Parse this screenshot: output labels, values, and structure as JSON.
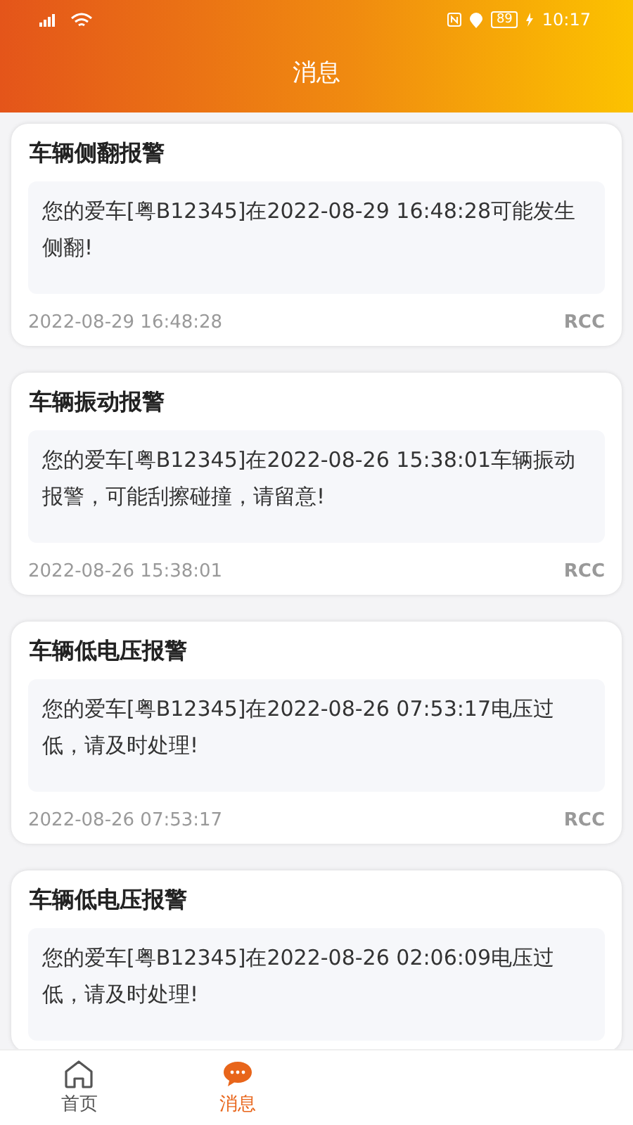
{
  "status_bar": {
    "battery": "89",
    "time": "10:17"
  },
  "header": {
    "title": "消息"
  },
  "messages": [
    {
      "title": "车辆侧翻报警",
      "body": "您的爱车[粤B12345]在2022-08-29 16:48:28可能发生侧翻!",
      "time": "2022-08-29 16:48:28",
      "source": "RCC"
    },
    {
      "title": "车辆振动报警",
      "body": "您的爱车[粤B12345]在2022-08-26 15:38:01车辆振动报警，可能刮擦碰撞，请留意!",
      "time": "2022-08-26 15:38:01",
      "source": "RCC"
    },
    {
      "title": "车辆低电压报警",
      "body": "您的爱车[粤B12345]在2022-08-26 07:53:17电压过低，请及时处理!",
      "time": "2022-08-26 07:53:17",
      "source": "RCC"
    },
    {
      "title": "车辆低电压报警",
      "body": "您的爱车[粤B12345]在2022-08-26 02:06:09电压过低，请及时处理!"
    }
  ],
  "tab_bar": [
    {
      "label": "首页",
      "kind": "home",
      "selected": false
    },
    {
      "label": "消息",
      "kind": "messages",
      "selected": true
    }
  ]
}
